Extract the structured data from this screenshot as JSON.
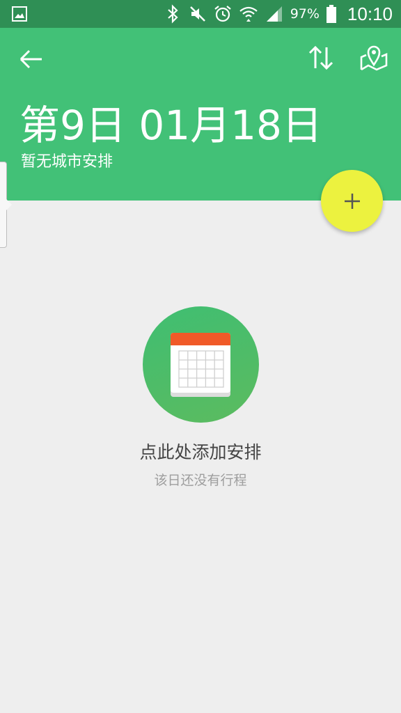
{
  "status_bar": {
    "battery_percent": "97%",
    "time": "10:10",
    "icons": [
      "gallery-icon",
      "bluetooth-icon",
      "mute-icon",
      "alarm-icon",
      "wifi-icon",
      "signal-icon",
      "battery-icon"
    ]
  },
  "header": {
    "title": "第9日 01月18日",
    "subtitle": "暂无城市安排",
    "icons": [
      "back-arrow-icon",
      "sort-icon",
      "map-pin-icon"
    ],
    "color": "#42c177"
  },
  "fab": {
    "icon": "plus-icon",
    "color": "#ecf23f"
  },
  "empty_state": {
    "icon": "calendar-icon",
    "title": "点此处添加安排",
    "subtitle": "该日还没有行程"
  },
  "colors": {
    "status_bar": "#2f8f55",
    "background": "#eeeeee",
    "calendar_header": "#f05a28"
  }
}
